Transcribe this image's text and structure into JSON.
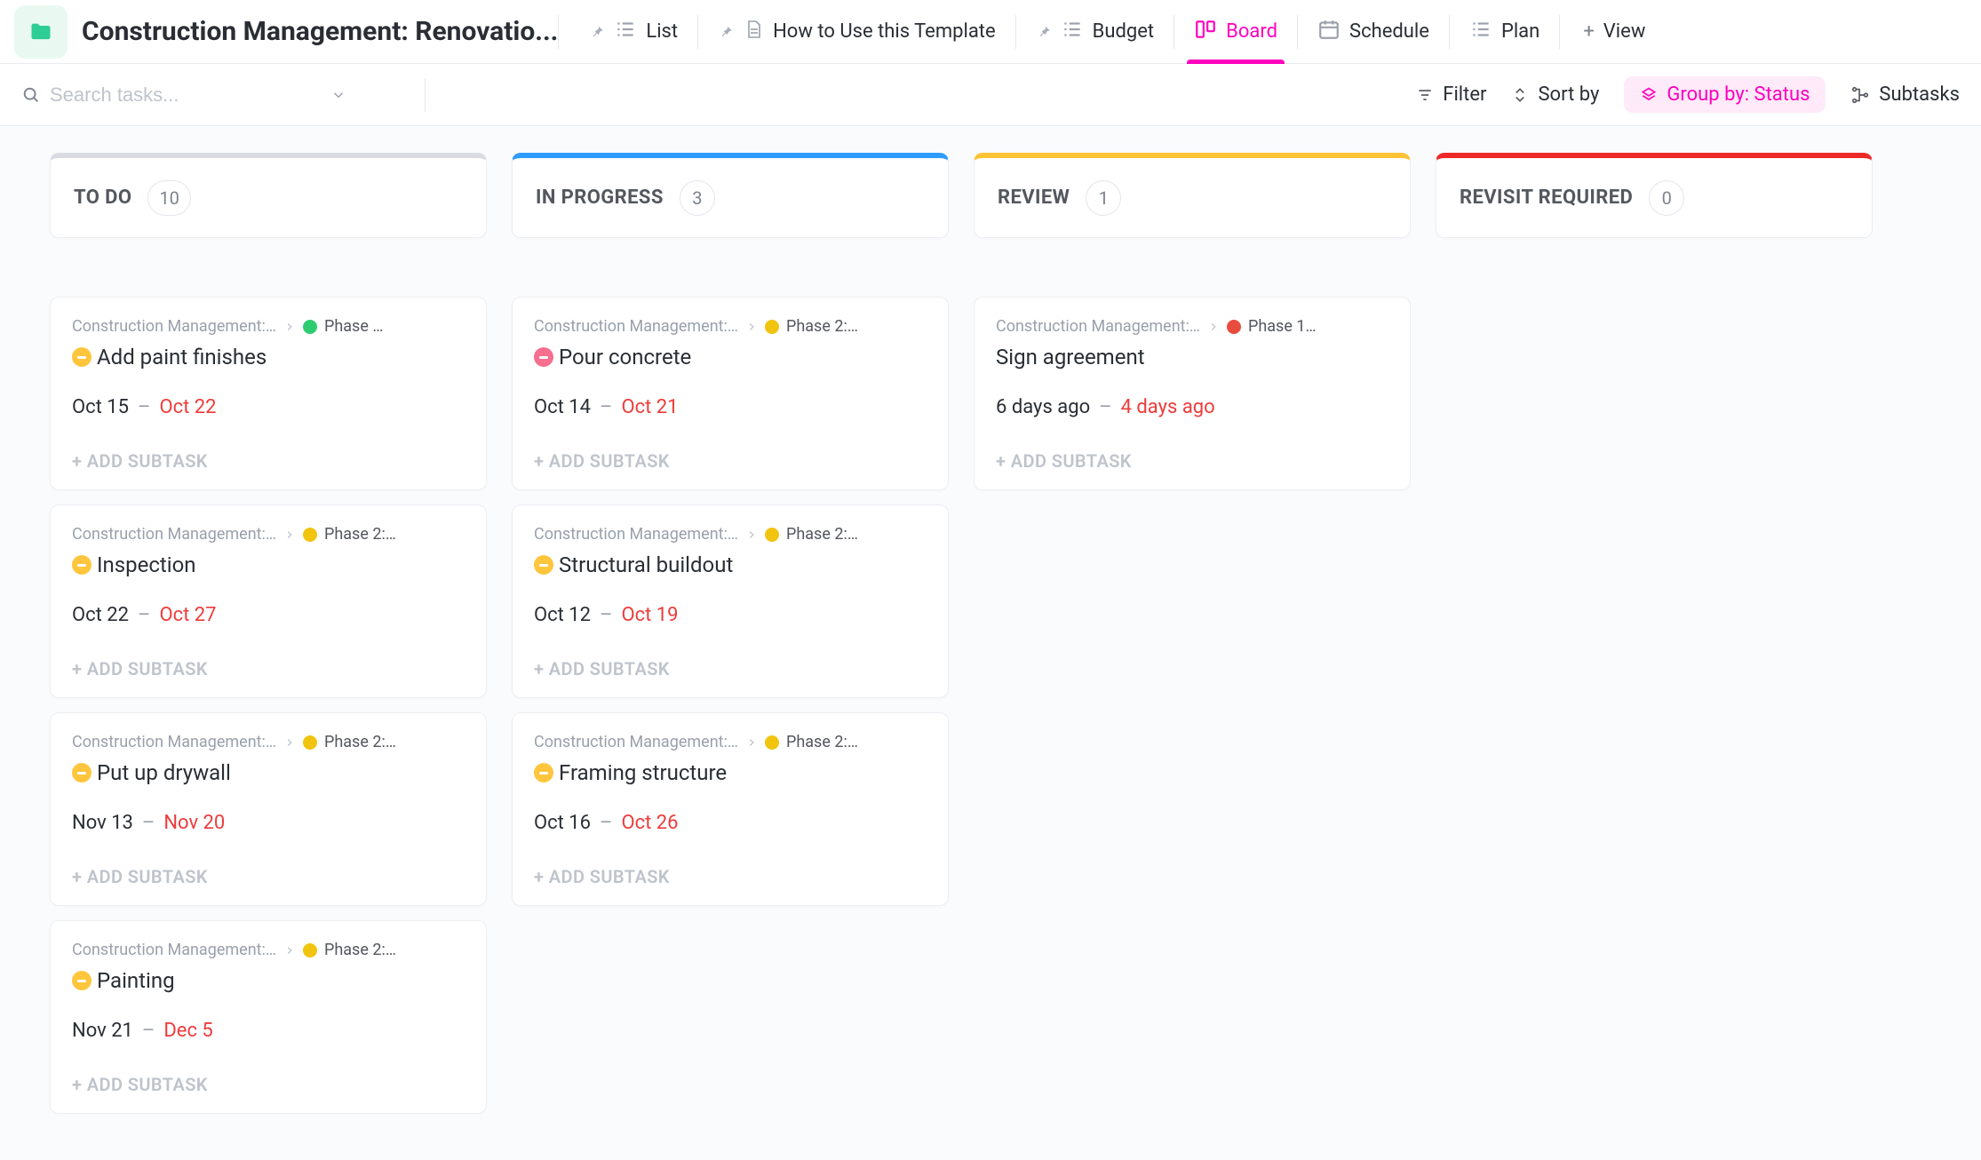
{
  "header": {
    "title": "Construction Management: Renovatio...",
    "tabs": [
      {
        "label": "List",
        "icon": "list",
        "pinned": true
      },
      {
        "label": "How to Use this Template",
        "icon": "doc",
        "pinned": true
      },
      {
        "label": "Budget",
        "icon": "list",
        "pinned": true
      },
      {
        "label": "Board",
        "icon": "board",
        "pinned": false,
        "active": true
      },
      {
        "label": "Schedule",
        "icon": "calendar",
        "pinned": false
      },
      {
        "label": "Plan",
        "icon": "list",
        "pinned": false
      }
    ],
    "add_view_label": "View"
  },
  "toolbar": {
    "search_placeholder": "Search tasks...",
    "filter_label": "Filter",
    "sort_label": "Sort by",
    "group_by_label": "Group by: Status",
    "subtasks_label": "Subtasks"
  },
  "board": {
    "columns": [
      {
        "title": "TO DO",
        "count": "10",
        "color": "#d9dbe1",
        "cards": [
          {
            "crumb1": "Construction Management: Ren…",
            "dot": "green",
            "crumb2": "Phase …",
            "priority": "yellow",
            "title": "Add paint finishes",
            "start": "Oct 15",
            "due": "Oct 22"
          },
          {
            "crumb1": "Construction Management: R…",
            "dot": "yellow",
            "crumb2": "Phase 2:…",
            "priority": "yellow",
            "title": "Inspection",
            "start": "Oct 22",
            "due": "Oct 27"
          },
          {
            "crumb1": "Construction Management: R…",
            "dot": "yellow",
            "crumb2": "Phase 2:…",
            "priority": "yellow",
            "title": "Put up drywall",
            "start": "Nov 13",
            "due": "Nov 20"
          },
          {
            "crumb1": "Construction Management: R…",
            "dot": "yellow",
            "crumb2": "Phase 2:…",
            "priority": "yellow",
            "title": "Painting",
            "start": "Nov 21",
            "due": "Dec 5"
          }
        ]
      },
      {
        "title": "IN PROGRESS",
        "count": "3",
        "color": "#2e9cff",
        "cards": [
          {
            "crumb1": "Construction Management: R…",
            "dot": "yellow",
            "crumb2": "Phase 2:…",
            "priority": "red",
            "title": "Pour concrete",
            "start": "Oct 14",
            "due": "Oct 21"
          },
          {
            "crumb1": "Construction Management: R…",
            "dot": "yellow",
            "crumb2": "Phase 2:…",
            "priority": "yellow",
            "title": "Structural buildout",
            "start": "Oct 12",
            "due": "Oct 19"
          },
          {
            "crumb1": "Construction Management: R…",
            "dot": "yellow",
            "crumb2": "Phase 2:…",
            "priority": "yellow",
            "title": "Framing structure",
            "start": "Oct 16",
            "due": "Oct 26"
          }
        ]
      },
      {
        "title": "REVIEW",
        "count": "1",
        "color": "#ffc233",
        "cards": [
          {
            "crumb1": "Construction Management: Ren…",
            "dot": "red",
            "crumb2": "Phase 1…",
            "priority": "none",
            "title": "Sign agreement",
            "start": "6 days ago",
            "due": "4 days ago"
          }
        ]
      },
      {
        "title": "REVISIT REQUIRED",
        "count": "0",
        "color": "#ef2828",
        "cards": []
      }
    ],
    "add_subtask_label": "ADD SUBTASK"
  }
}
